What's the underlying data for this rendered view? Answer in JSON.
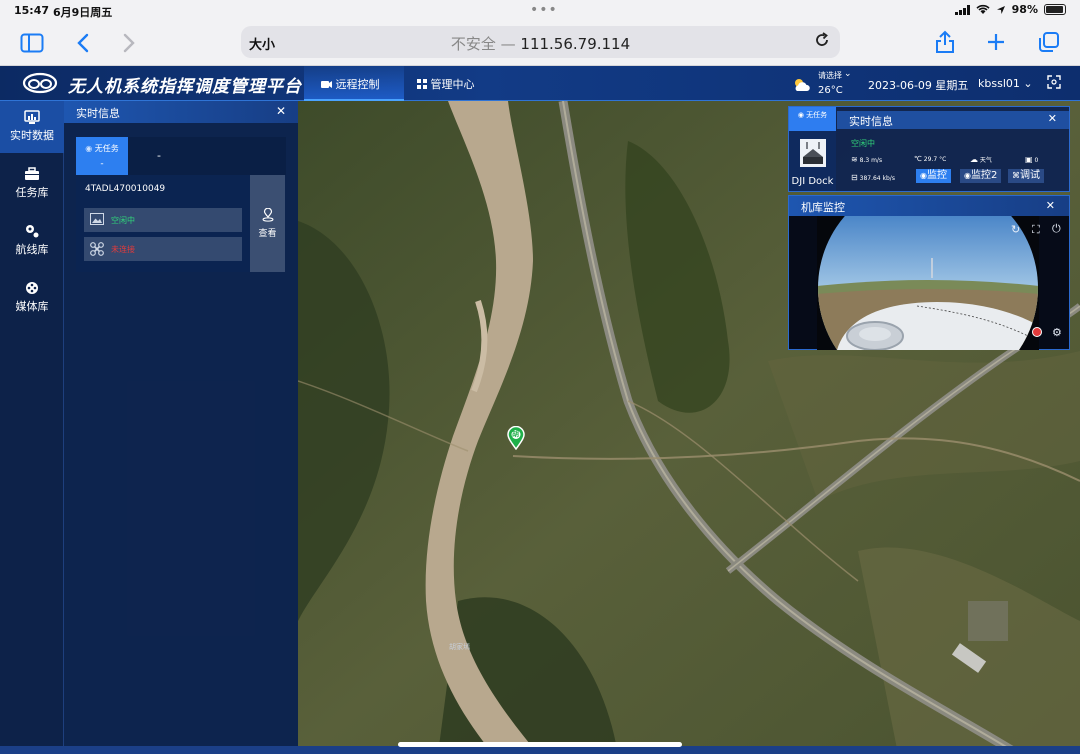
{
  "status": {
    "time": "15:47",
    "date": "6月9日周五",
    "battery": "98%"
  },
  "browser": {
    "text_size": "大小",
    "insecure": "不安全",
    "host": "111.56.79.114"
  },
  "app": {
    "title": "无人机系统指挥调度管理平台"
  },
  "nav": {
    "remote_control": "远程控制",
    "management": "管理中心"
  },
  "weather": {
    "select_label": "请选择",
    "temperature": "26°C"
  },
  "header": {
    "date": "2023-06-09 星期五",
    "user": "kbssl01"
  },
  "sidebar": {
    "items": [
      {
        "label": "实时数据"
      },
      {
        "label": "任务库"
      },
      {
        "label": "航线库"
      },
      {
        "label": "媒体库"
      }
    ]
  },
  "left_panel": {
    "title": "实时信息",
    "tab_active": "无任务",
    "tab_active_sub": "-",
    "tab_second": "-",
    "device_sn": "4TADL470010049",
    "row1_status": "空闲中",
    "row2_status": "未连接",
    "view_label": "查看"
  },
  "dock": {
    "badge": "无任务",
    "name": "DJI Dock",
    "title": "实时信息",
    "status": "空闲中",
    "wind": "8.3 m/s",
    "temp": "29.7 °C",
    "weather": "天气",
    "count": "0",
    "network": "387.64 kb/s",
    "btn_monitor": "监控",
    "btn_monitor2": "监控2",
    "btn_debug": "调试"
  },
  "hangar": {
    "title": "机库监控"
  },
  "map": {
    "place": "胡家墕",
    "pin": "胡"
  },
  "colors": {
    "accent": "#2d7ff0",
    "ok": "#31d47a",
    "bad": "#e33b3b",
    "header": "#123b86"
  }
}
